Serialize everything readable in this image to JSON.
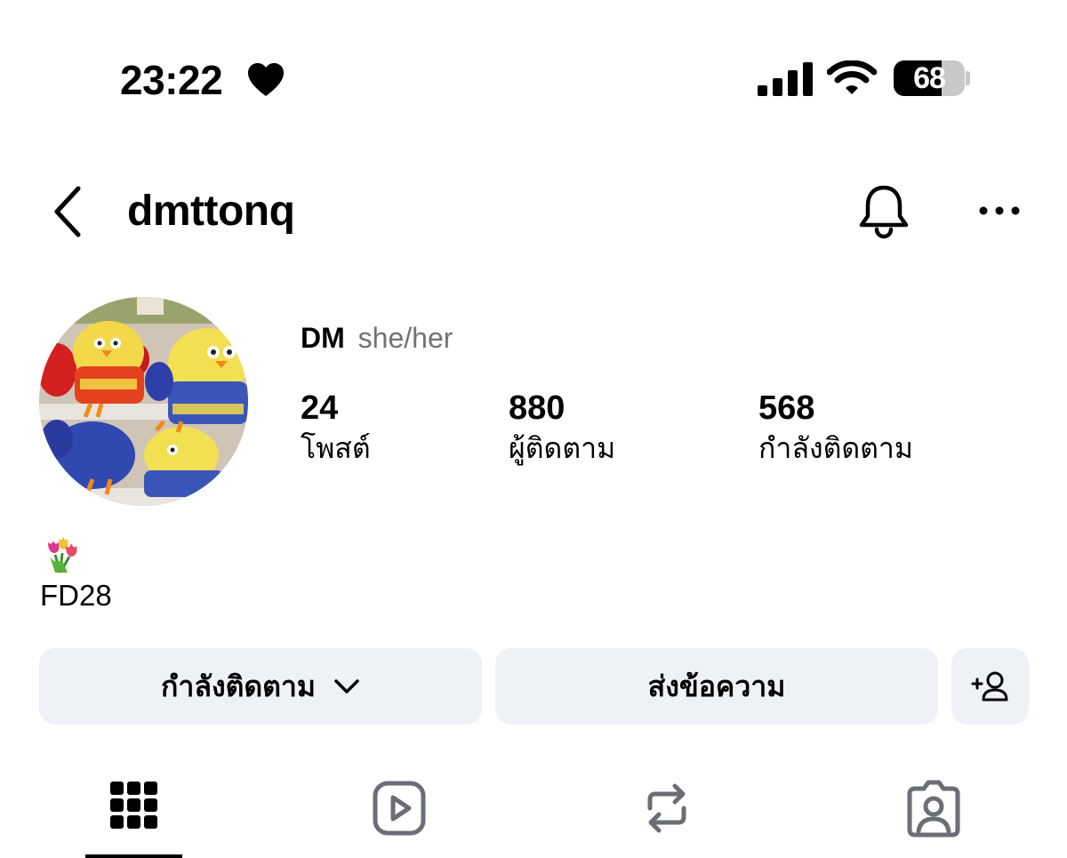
{
  "status_bar": {
    "time": "23:22",
    "battery_percent": "68",
    "battery_level": 0.68,
    "icons": [
      "heart-icon",
      "signal-bars-icon",
      "wifi-icon",
      "battery-icon"
    ]
  },
  "header": {
    "username": "dmttonq",
    "icons": [
      "chevron-left-icon",
      "bell-icon",
      "more-dots-icon"
    ]
  },
  "profile": {
    "display_name": "DM",
    "pronouns": "she/her",
    "stats": [
      {
        "value": "24",
        "label": "โพสต์"
      },
      {
        "value": "880",
        "label": "ผู้ติดตาม"
      },
      {
        "value": "568",
        "label": "กำลังติดตาม"
      }
    ],
    "bio_text": "FD28",
    "bio_emoji": "tulip-bouquet-icon"
  },
  "actions": {
    "following_label": "กำลังติดตาม",
    "message_label": "ส่งข้อความ",
    "add_user_icon": "add-user-icon"
  },
  "tabs": [
    "grid-icon",
    "reels-icon",
    "reposts-icon",
    "tagged-icon"
  ],
  "colors": {
    "button_bg": "#eef1f5",
    "secondary_text": "#737373",
    "text": "#000000",
    "tab_icon_inactive": "#6b6f75"
  }
}
